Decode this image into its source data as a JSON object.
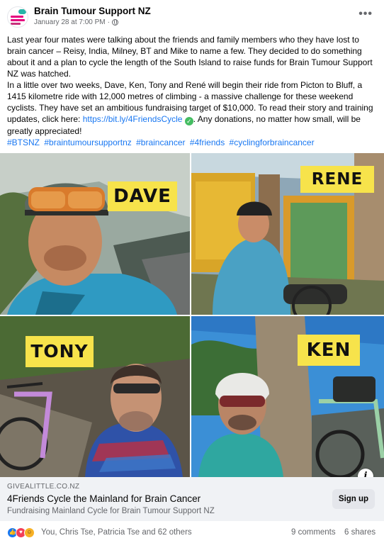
{
  "post": {
    "page_name": "Brain Tumour Support NZ",
    "date": "January 28 at 7:00 PM",
    "separator": "·",
    "more_label": "•••",
    "paragraph1": "Last year four mates were talking about the friends and family members who they have lost to brain cancer – Reisy, India, Milney, BT and Mike to name a few. They decided to do something about it and a plan to cycle the length of the South Island to raise funds for Brain Tumour Support NZ was hatched.",
    "paragraph2_before_link": "In a little over two weeks, Dave, Ken, Tony and René will begin their ride from Picton to Bluff, a 1415 kilometre ride with 12,000 metres of climbing - a massive challenge for these weekend cyclists. They have set an ambitious fundraising target of $10,000. To read their story and training updates, click here: ",
    "link_text": "https://bit.ly/4FriendsCycle",
    "check_glyph": "✓",
    "paragraph2_after_link": ". Any donations, no matter how small, will be greatly appreciated!",
    "hashtags": [
      "#BTSNZ",
      "#braintumoursupportnz",
      "#braincancer",
      "#4friends",
      "#cyclingforbraincancer"
    ]
  },
  "photos": {
    "dave": "DAVE",
    "rene": "RENE",
    "tony": "TONY",
    "ken": "KEN"
  },
  "link_card": {
    "domain": "GIVEALITTLE.CO.NZ",
    "title": "4Friends Cycle the Mainland for Brain Cancer",
    "subtitle": "Fundraising Mainland Cycle for Brain Tumour Support NZ",
    "signup_label": "Sign up",
    "info_glyph": "i"
  },
  "footer": {
    "reaction_names": "You, Chris Tse, Patricia Tse and 62 others",
    "comments": "9 comments",
    "shares": "6 shares",
    "reactions": [
      "like-icon",
      "love-icon",
      "care-icon"
    ]
  }
}
